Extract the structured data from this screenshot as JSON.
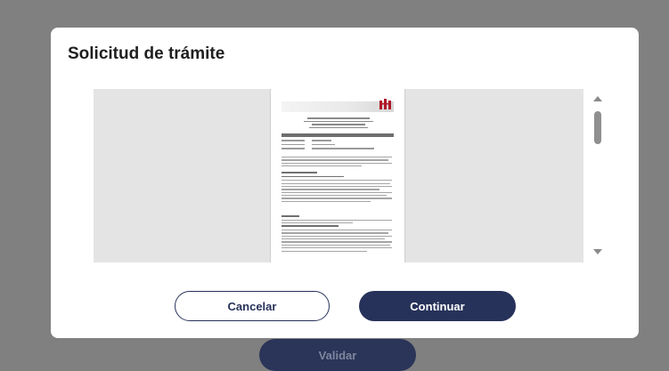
{
  "background": {
    "validate_label": "Validar"
  },
  "modal": {
    "title": "Solicitud de trámite",
    "buttons": {
      "cancel_label": "Cancelar",
      "continue_label": "Continuar"
    }
  },
  "document_viewer": {
    "scroll_up_icon": "triangle-up",
    "scroll_down_icon": "triangle-down"
  },
  "colors": {
    "primary": "#27325a",
    "overlay": "#808080",
    "viewer_bg": "#e4e4e4"
  }
}
